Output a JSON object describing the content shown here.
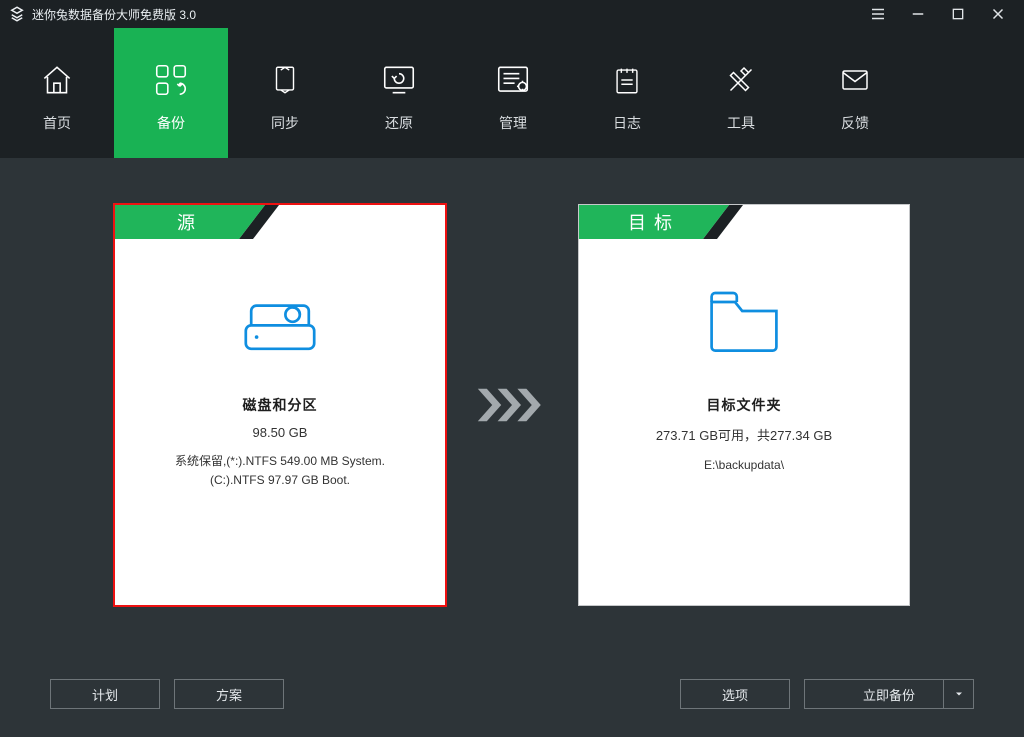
{
  "app": {
    "title": "迷你兔数据备份大师免费版 3.0"
  },
  "nav": {
    "items": [
      {
        "label": "首页"
      },
      {
        "label": "备份"
      },
      {
        "label": "同步"
      },
      {
        "label": "还原"
      },
      {
        "label": "管理"
      },
      {
        "label": "日志"
      },
      {
        "label": "工具"
      },
      {
        "label": "反馈"
      }
    ],
    "active_index": 1
  },
  "source": {
    "tab": "源",
    "title": "磁盘和分区",
    "size": "98.50 GB",
    "line1": "系统保留,(*:).NTFS 549.00 MB System.",
    "line2": "(C:).NTFS 97.97 GB Boot."
  },
  "target": {
    "tab": "目标",
    "title": "目标文件夹",
    "size": "273.71 GB可用，共277.34 GB",
    "path": "E:\\backupdata\\"
  },
  "buttons": {
    "plan": "计划",
    "scheme": "方案",
    "options": "选项",
    "backup_now": "立即备份"
  },
  "colors": {
    "accent": "#20b55a",
    "bg_dark": "#1c2124",
    "bg": "#2d3438"
  }
}
